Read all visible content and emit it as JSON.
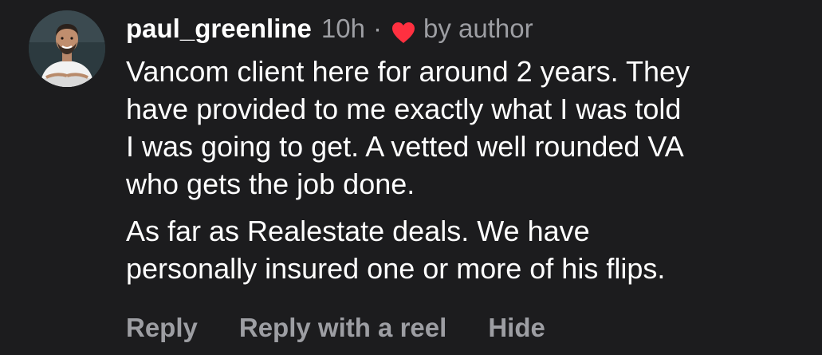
{
  "comment": {
    "username": "paul_greenline",
    "time": "10h",
    "separator": "·",
    "liked_by": "by author",
    "heart_color": "#ff3040",
    "icons": {
      "avatar": "profile-photo",
      "like": "heart-icon"
    },
    "text_lines_p1": [
      "Vancom client here for around 2 years. They",
      "have provided to me exactly what I was told",
      "I was going to get. A vetted well rounded VA",
      "who gets the job done."
    ],
    "text_lines_p2": [
      "As far as Realestate deals. We have",
      "personally insured one or more of his flips."
    ]
  },
  "actions": {
    "reply": "Reply",
    "reply_reel": "Reply with a reel",
    "hide": "Hide"
  }
}
